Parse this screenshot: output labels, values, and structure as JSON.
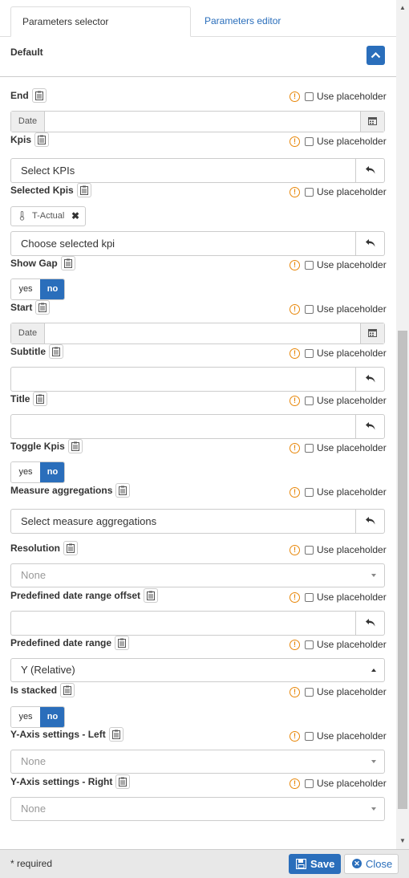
{
  "tabs": {
    "active": "Parameters selector",
    "inactive": "Parameters editor"
  },
  "section": {
    "title": "Default"
  },
  "placeholder_label": "Use placeholder",
  "params": {
    "end": {
      "label": "End",
      "date_label": "Date"
    },
    "kpis": {
      "label": "Kpis",
      "placeholder": "Select KPIs"
    },
    "selected_kpis": {
      "label": "Selected Kpis",
      "chip": "T-Actual",
      "placeholder": "Choose selected kpi"
    },
    "show_gap": {
      "label": "Show Gap",
      "yes": "yes",
      "no": "no",
      "value": "no"
    },
    "start": {
      "label": "Start",
      "date_label": "Date"
    },
    "subtitle": {
      "label": "Subtitle",
      "value": ""
    },
    "title": {
      "label": "Title",
      "value": ""
    },
    "toggle_kpis": {
      "label": "Toggle Kpis",
      "yes": "yes",
      "no": "no",
      "value": "no"
    },
    "measure_aggregations": {
      "label": "Measure aggregations",
      "placeholder": "Select measure aggregations"
    },
    "resolution": {
      "label": "Resolution",
      "value": "None"
    },
    "predefined_date_range_offset": {
      "label": "Predefined date range offset",
      "value": ""
    },
    "predefined_date_range": {
      "label": "Predefined date range",
      "value": "Y (Relative)"
    },
    "is_stacked": {
      "label": "Is stacked",
      "yes": "yes",
      "no": "no",
      "value": "no"
    },
    "y_axis_left": {
      "label": "Y-Axis settings - Left",
      "value": "None"
    },
    "y_axis_right": {
      "label": "Y-Axis settings - Right",
      "value": "None"
    }
  },
  "footer": {
    "required": "* required",
    "save": "Save",
    "close": "Close"
  },
  "colors": {
    "accent": "#2a6ebb",
    "warning": "#e8870a",
    "border": "#cccccc",
    "footer_bg": "#e8e8e8"
  },
  "icons": {
    "clipboard": "clipboard-icon",
    "warning": "warning-icon",
    "calendar": "calendar-icon",
    "undo": "undo-icon",
    "chevron": "chevron-up-icon",
    "save": "floppy-icon",
    "close": "close-circle-icon",
    "thermometer": "thermometer-icon"
  }
}
